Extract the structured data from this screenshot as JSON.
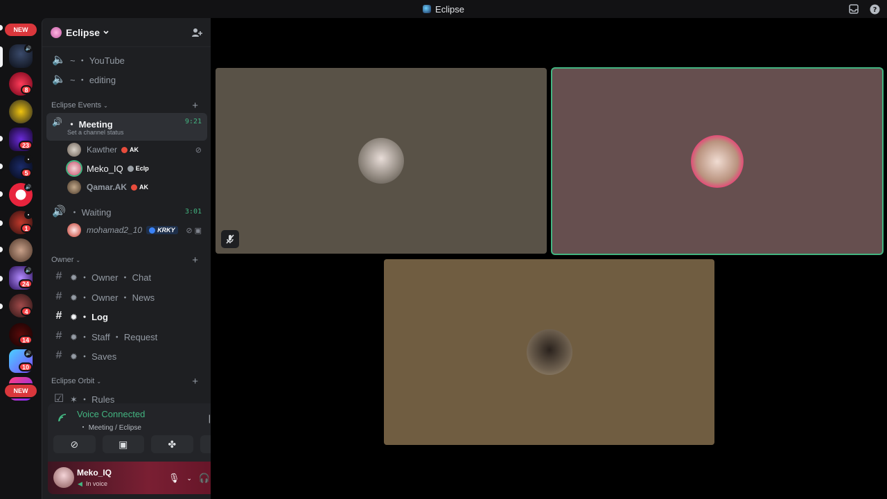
{
  "window": {
    "title": "Eclipse"
  },
  "rail": {
    "new_top": "NEW",
    "new_bottom": "NEW",
    "badges": [
      "8",
      "23",
      "5",
      "1",
      "24",
      "4",
      "14",
      "10"
    ]
  },
  "guild": {
    "name": "Eclipse"
  },
  "channels": {
    "youtube": "~ ・ YouTube",
    "editing": "~ ・ editing",
    "cat_events": "Eclipse Events",
    "meeting": {
      "name": "・ Meeting",
      "status": "Set a channel status",
      "timer": "9:21"
    },
    "meeting_users": [
      {
        "name": "Kawther",
        "tag": "AK"
      },
      {
        "name": "Meko_IQ",
        "tag": "Eclp"
      },
      {
        "name": "Qamar.AK",
        "tag": "AK"
      }
    ],
    "waiting": {
      "name": "・ Waiting",
      "timer": "3:01"
    },
    "waiting_users": [
      {
        "name": "mohamad2_10",
        "tag": "KRKY"
      }
    ],
    "cat_owner": "Owner",
    "owner_chat": "✹ ・ Owner ・ Chat",
    "owner_news": "✹ ・ Owner ・ News",
    "log": "✹ ・ Log",
    "staff_request": "✹ ・ Staff ・ Request",
    "saves": "✹ ・ Saves",
    "cat_orbit": "Eclipse Orbit",
    "rules": "✶ ・ Rules"
  },
  "voice": {
    "title": "Voice Connected",
    "subtitle": "・ Meeting / Eclipse"
  },
  "user": {
    "name": "Meko_IQ",
    "status": "In voice"
  },
  "colors": {
    "accent_green": "#43b581",
    "tile1": "#595247",
    "tile2": "#664f4f",
    "tile3": "#705d41"
  }
}
